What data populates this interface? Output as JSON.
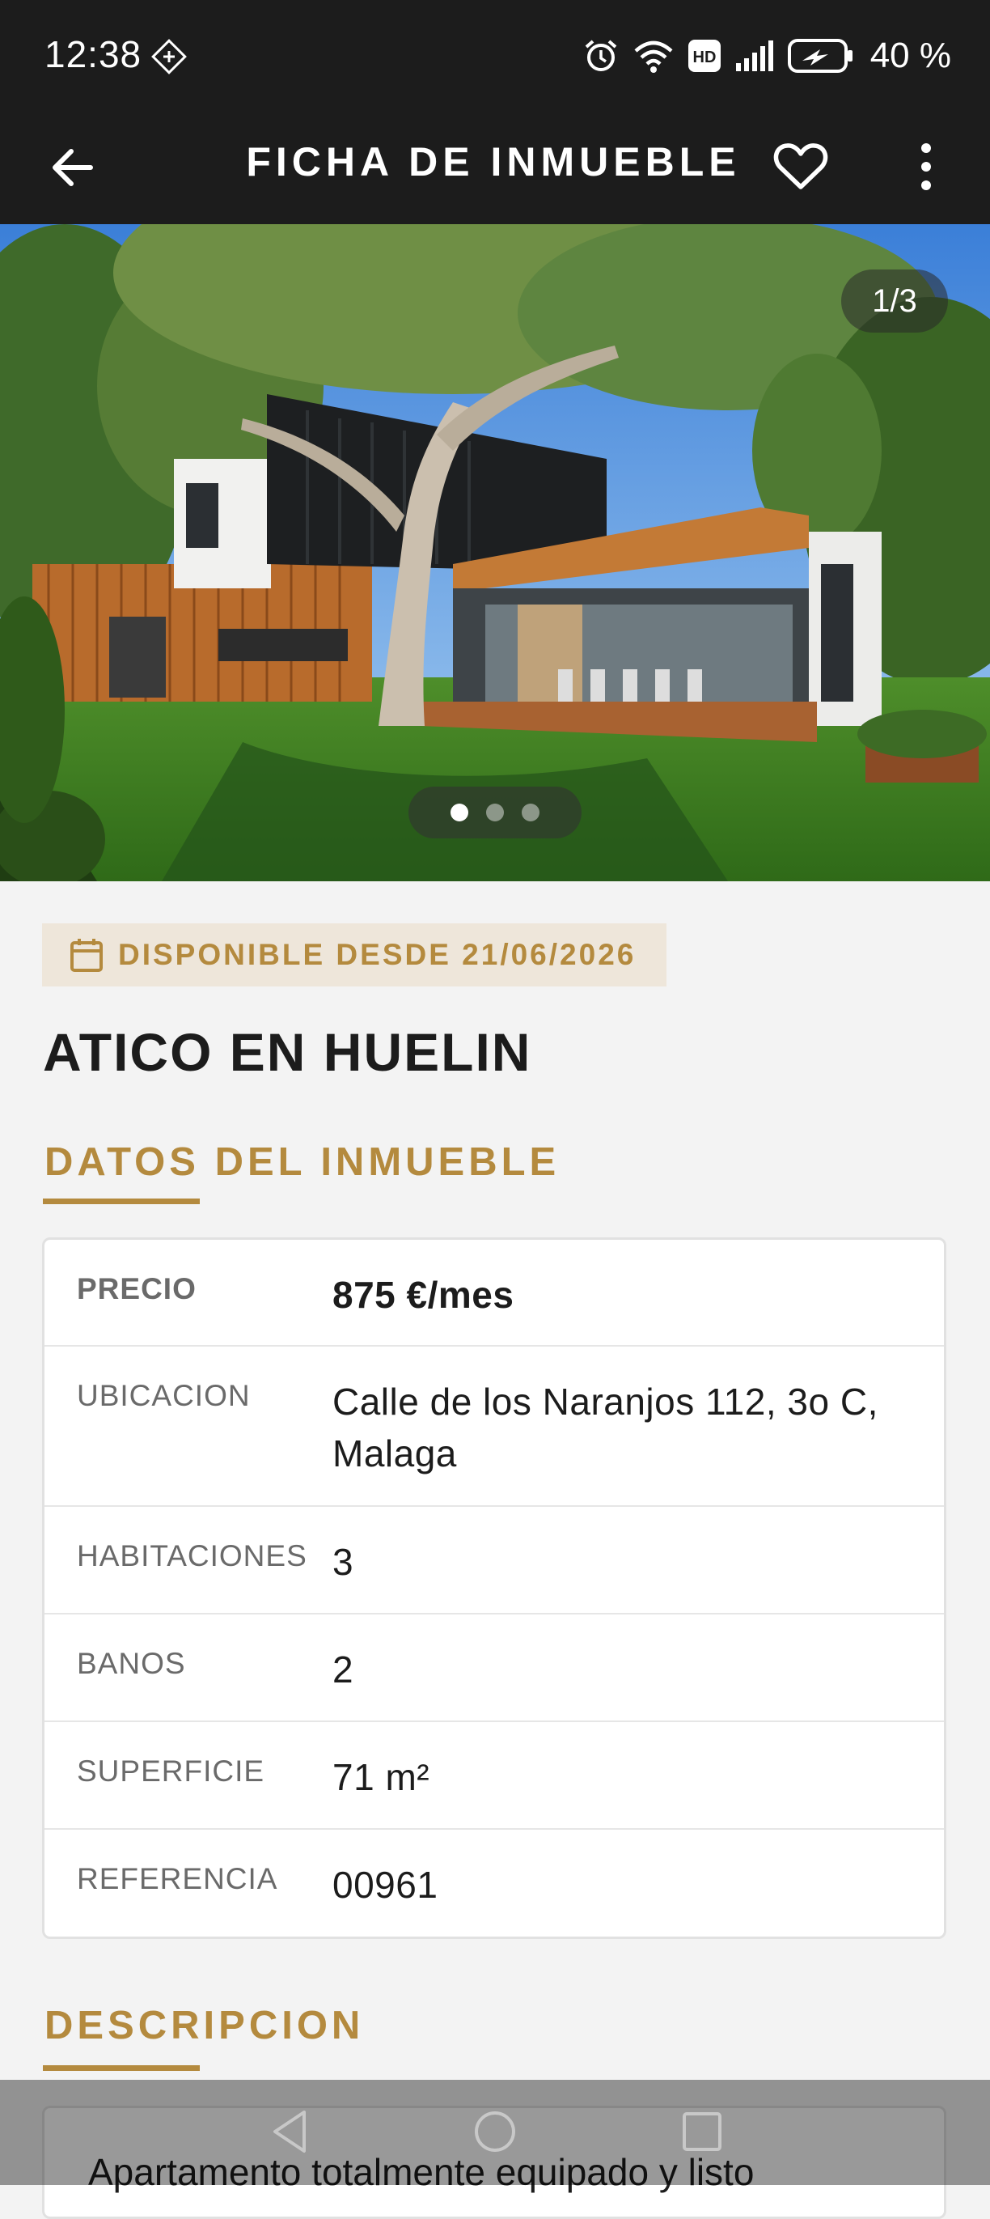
{
  "status_bar": {
    "time": "12:38",
    "battery": "40 %"
  },
  "app_bar": {
    "title": "FICHA DE INMUEBLE"
  },
  "gallery": {
    "counter": "1/3",
    "total": 3,
    "current": 1
  },
  "availability": "DISPONIBLE DESDE 21/06/2026",
  "property_title": "ATICO EN HUELIN",
  "details": {
    "heading": "DATOS DEL INMUEBLE",
    "rows": [
      {
        "label": "PRECIO",
        "value": "875 €/mes"
      },
      {
        "label": "UBICACION",
        "value": "Calle de los Naranjos 112, 3o C, Malaga"
      },
      {
        "label": "HABITACIONES",
        "value": "3"
      },
      {
        "label": "BANOS",
        "value": "2"
      },
      {
        "label": "SUPERFICIE",
        "value": "71 m²"
      },
      {
        "label": "REFERENCIA",
        "value": "00961"
      }
    ]
  },
  "description": {
    "heading": "DESCRIPCION",
    "text": "Apartamento totalmente equipado y listo"
  },
  "colors": {
    "accent": "#b48a3e",
    "appbar": "#1c1c1c",
    "background": "#f3f3f3"
  },
  "icons": [
    "sync-icon",
    "alarm-icon",
    "wifi-icon",
    "hd-icon",
    "signal-icon",
    "battery-icon",
    "back-arrow-icon",
    "heart-icon",
    "more-vert-icon",
    "calendar-icon",
    "nav-back-icon",
    "nav-home-icon",
    "nav-recents-icon"
  ]
}
